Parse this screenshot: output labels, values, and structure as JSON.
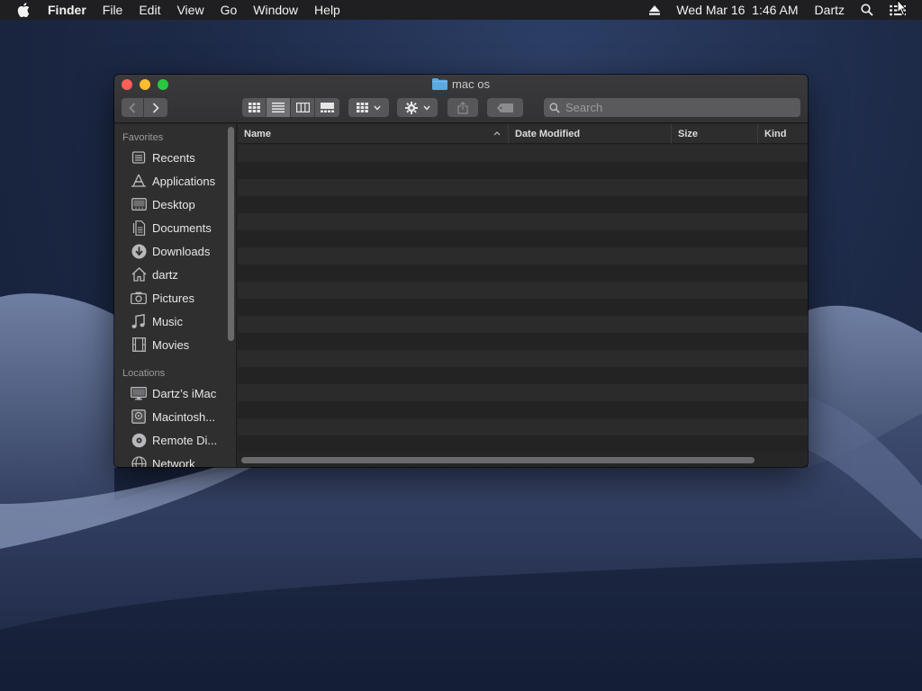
{
  "menubar": {
    "app_name": "Finder",
    "items": [
      "File",
      "Edit",
      "View",
      "Go",
      "Window",
      "Help"
    ],
    "datetime": "Wed Mar 16  1:46 AM",
    "user": "Dartz"
  },
  "window": {
    "title": "mac os",
    "search_placeholder": "Search"
  },
  "sidebar": {
    "favorites_header": "Favorites",
    "favorites": [
      {
        "label": "Recents",
        "icon": "recents-icon"
      },
      {
        "label": "Applications",
        "icon": "applications-icon"
      },
      {
        "label": "Desktop",
        "icon": "desktop-icon"
      },
      {
        "label": "Documents",
        "icon": "documents-icon"
      },
      {
        "label": "Downloads",
        "icon": "downloads-icon"
      },
      {
        "label": "dartz",
        "icon": "home-icon"
      },
      {
        "label": "Pictures",
        "icon": "pictures-icon"
      },
      {
        "label": "Music",
        "icon": "music-icon"
      },
      {
        "label": "Movies",
        "icon": "movies-icon"
      }
    ],
    "locations_header": "Locations",
    "locations": [
      {
        "label": "Dartz’s iMac",
        "icon": "imac-icon"
      },
      {
        "label": "Macintosh...",
        "icon": "disk-icon"
      },
      {
        "label": "Remote Di...",
        "icon": "remote-disc-icon"
      },
      {
        "label": "Network",
        "icon": "network-icon"
      }
    ]
  },
  "list": {
    "columns": [
      "Name",
      "Date Modified",
      "Size",
      "Kind"
    ]
  },
  "colors": {
    "close": "#fe5f57",
    "minimize": "#febc2e",
    "maximize": "#28c840",
    "folder": "#5aa9e0"
  }
}
